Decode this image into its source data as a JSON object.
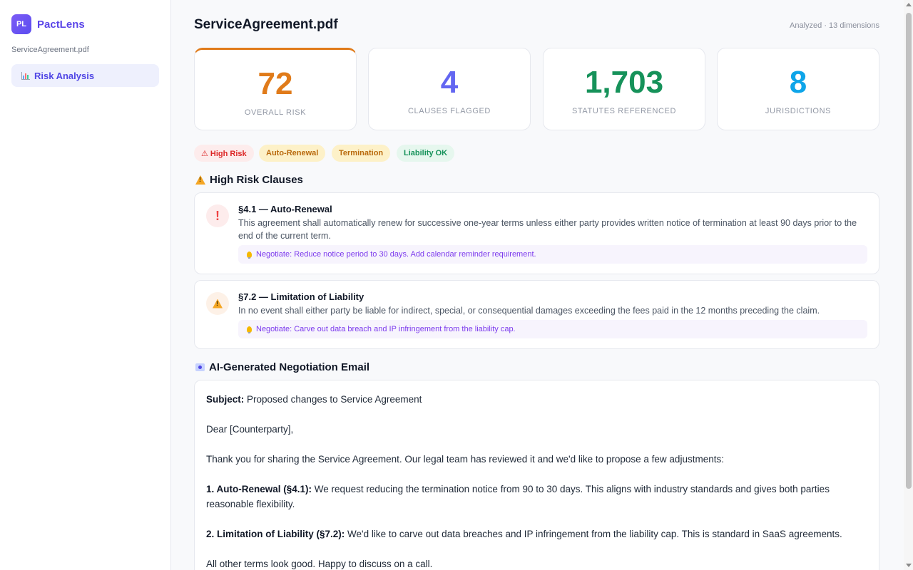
{
  "app": {
    "logo_text": "PL",
    "name": "PactLens"
  },
  "sidebar": {
    "file_name": "ServiceAgreement.pdf",
    "nav": [
      {
        "label": "Risk Analysis",
        "icon": "bar-chart-icon",
        "active": true
      }
    ]
  },
  "header": {
    "title": "ServiceAgreement.pdf",
    "meta": "Analyzed · 13 dimensions"
  },
  "stats": [
    {
      "value": "72",
      "label": "OVERALL RISK",
      "color": "#e07b1a"
    },
    {
      "value": "4",
      "label": "CLAUSES FLAGGED",
      "color": "#6366f1"
    },
    {
      "value": "1,703",
      "label": "STATUTES REFERENCED",
      "color": "#16925a"
    },
    {
      "value": "8",
      "label": "JURISDICTIONS",
      "color": "#0ea5e9"
    }
  ],
  "tags": [
    {
      "label": "⚠ High Risk",
      "tone": "red"
    },
    {
      "label": "Auto-Renewal",
      "tone": "yellow"
    },
    {
      "label": "Termination",
      "tone": "yellow"
    },
    {
      "label": "Liability OK",
      "tone": "green"
    }
  ],
  "high_risk": {
    "heading": "High Risk Clauses",
    "clauses": [
      {
        "icon": "exclamation-icon",
        "icon_glyph": "!",
        "title": "§4.1 — Auto-Renewal",
        "text": "This agreement shall automatically renew for successive one-year terms unless either party provides written notice of termination at least 90 days prior to the end of the current term.",
        "tip": "Negotiate: Reduce notice period to 30 days. Add calendar reminder requirement."
      },
      {
        "icon": "warning-icon",
        "title": "§7.2 — Limitation of Liability",
        "text": "In no event shall either party be liable for indirect, special, or consequential damages exceeding the fees paid in the 12 months preceding the claim.",
        "tip": "Negotiate: Carve out data breach and IP infringement from the liability cap."
      }
    ]
  },
  "email": {
    "heading": "AI-Generated Negotiation Email",
    "subject_label": "Subject:",
    "subject": "Proposed changes to Service Agreement",
    "greeting": "Dear [Counterparty],",
    "intro": "Thank you for sharing the Service Agreement. Our legal team has reviewed it and we'd like to propose a few adjustments:",
    "point1_label": "1. Auto-Renewal (§4.1):",
    "point1": "We request reducing the termination notice from 90 to 30 days. This aligns with industry standards and gives both parties reasonable flexibility.",
    "point2_label": "2. Limitation of Liability (§7.2):",
    "point2": "We'd like to carve out data breaches and IP infringement from the liability cap. This is standard in SaaS agreements.",
    "closing": "All other terms look good. Happy to discuss on a call."
  }
}
